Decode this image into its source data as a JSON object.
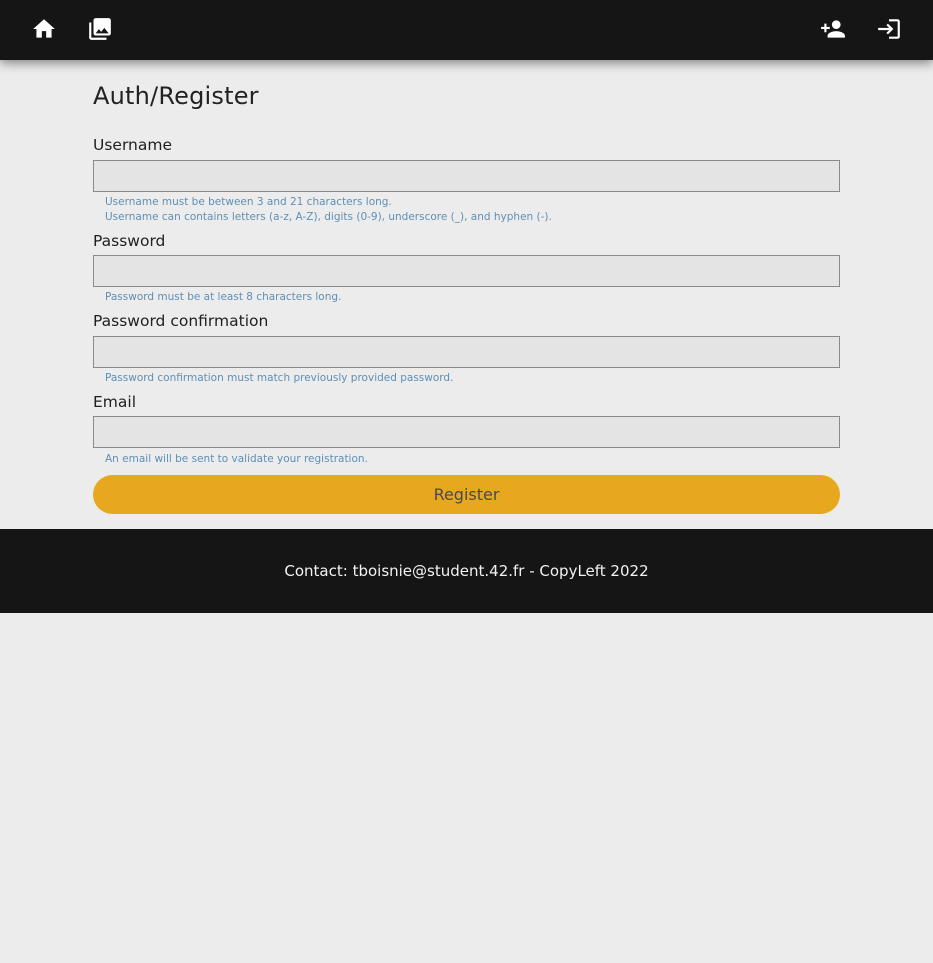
{
  "nav": {
    "home_icon": "home-icon",
    "gallery_icon": "photo-library-icon",
    "register_icon": "person-add-icon",
    "login_icon": "login-icon"
  },
  "page": {
    "title": "Auth/Register"
  },
  "form": {
    "username": {
      "label": "Username",
      "value": "",
      "hints": [
        "Username must be between 3 and 21 characters long.",
        "Username can contains letters (a-z, A-Z), digits (0-9), underscore (_), and hyphen (-)."
      ]
    },
    "password": {
      "label": "Password",
      "value": "",
      "hints": [
        "Password must be at least 8 characters long."
      ]
    },
    "password_confirmation": {
      "label": "Password confirmation",
      "value": "",
      "hints": [
        "Password confirmation must match previously provided password."
      ]
    },
    "email": {
      "label": "Email",
      "value": "",
      "hints": [
        "An email will be sent to validate your registration."
      ]
    },
    "submit_label": "Register"
  },
  "footer": {
    "text": "Contact: tboisnie@student.42.fr - CopyLeft 2022"
  },
  "colors": {
    "topbar": "#151515",
    "background": "#ececec",
    "accent": "#e7a81f",
    "hint": "#5f8fb5"
  }
}
